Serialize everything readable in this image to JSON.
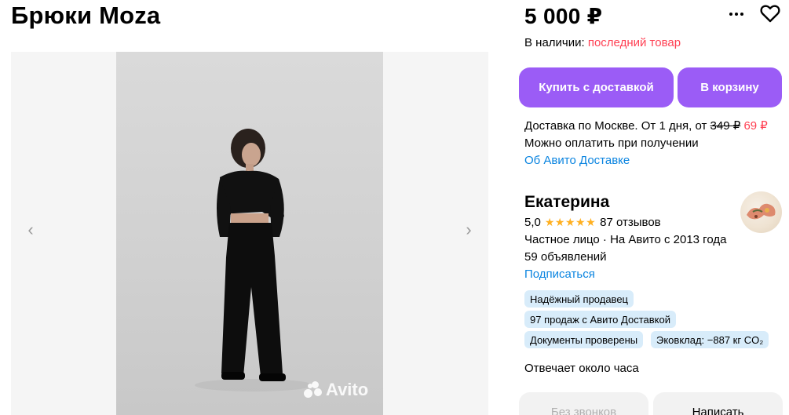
{
  "listing": {
    "title": "Брюки Moza"
  },
  "gallery": {
    "prev_label": "‹",
    "next_label": "›",
    "watermark": "Avito"
  },
  "offer": {
    "price": "5 000 ₽",
    "availability_label": "В наличии:",
    "availability_value": "последний товар",
    "buy_label": "Купить с доставкой",
    "cart_label": "В корзину"
  },
  "delivery": {
    "line1_prefix": "Доставка по Москве. От 1 дня, от",
    "old_price": "349 ₽",
    "new_price": "69 ₽",
    "line2": "Можно оплатить при получении",
    "link": "Об Авито Доставке"
  },
  "seller": {
    "name": "Екатерина",
    "rating": "5,0",
    "stars": "★★★★★",
    "reviews": "87 отзывов",
    "type": "Частное лицо · На Авито с 2013 года",
    "ads": "59 объявлений",
    "subscribe": "Подписаться",
    "badges": [
      "Надёжный продавец",
      "97 продаж с Авито Доставкой",
      "Документы проверены",
      "Эковклад: −887 кг CO₂"
    ],
    "response": "Отвечает около часа"
  },
  "contact": {
    "no_calls": "Без звонков",
    "write": "Написать"
  },
  "icons": {
    "more": "more-dots-icon",
    "favorite": "heart-icon",
    "stars": "star-icon"
  },
  "colors": {
    "accent": "#9b5cf6",
    "warning": "#ff4053",
    "link": "#0a84e0",
    "star": "#ffb021",
    "badge": "#d8ecfa"
  }
}
